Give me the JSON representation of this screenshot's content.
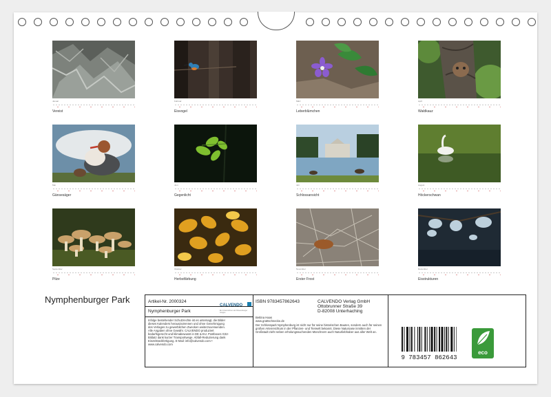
{
  "title": "Nymphenburger Park",
  "months": [
    {
      "label": "Januar",
      "caption": "Vereist"
    },
    {
      "label": "Februar",
      "caption": "Eisvogel"
    },
    {
      "label": "März",
      "caption": "Leberblümchen"
    },
    {
      "label": "April",
      "caption": "Waldkauz"
    },
    {
      "label": "Mai",
      "caption": "Gänsesäger"
    },
    {
      "label": "Juni",
      "caption": "Gegenlicht"
    },
    {
      "label": "Juli",
      "caption": "Schlossansicht"
    },
    {
      "label": "August",
      "caption": "Höckerschwan"
    },
    {
      "label": "September",
      "caption": "Pilze"
    },
    {
      "label": "Oktober",
      "caption": "Herbstfärbung"
    },
    {
      "label": "November",
      "caption": "Erster Frost"
    },
    {
      "label": "Dezember",
      "caption": "Eisstrukturen"
    }
  ],
  "info": {
    "article": "Artikel-Nr. 2000324",
    "brand": "CALVENDO",
    "brand_sub": "Ein Unternehmen der Ravensburger Gruppe",
    "product_title": "Nymphenburger Park",
    "legal": "Infolge bestehender Schutzrechte ist es untersagt, die Bilder dieses Kalenders herauszutrennen und ohne Genehmigung des Verlages zu gewerblichen Zwecken weiterzuverwenden. Alle Angaben ohne Gewähr. CALVENDO produziert bedarfsgerecht und klimabewusst in DE & EU. Postboxes G32-Bildatz dank kurzer Transportwege. Abfall-Reduzierung dank Einzelstückfertigung. E-Mail: info@calvendo.com • www.calvendo.com",
    "isbn": "ISBN 9783457862643",
    "publisher_name": "CALVENDO Verlag GmbH",
    "publisher_street": "Ottobrunner Straße 39",
    "publisher_city": "D-82008 Unterhaching",
    "author_name": "Bettina Haas",
    "author_site": "www.grattschnecke.de",
    "description": "Der Schlosspark Nymphenburg ist nicht nur für seine historischen Bauten, sondern auch für seinen großen Artenreichtum in der Pflanzen- und Tierwelt bekannt. Diese Naturoase inmitten der Großstadt zieht neben erholungssuchenden Münchnern auch Naturliebhaber aus aller Welt an.",
    "barcode_digits": "9 783457 862643",
    "eco_label": "eco"
  }
}
